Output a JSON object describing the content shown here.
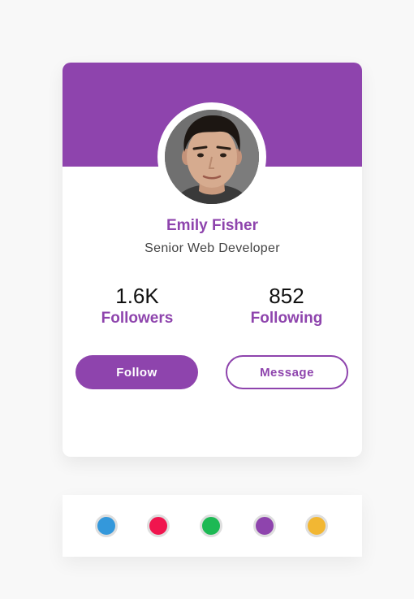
{
  "profile": {
    "name": "Emily Fisher",
    "title": "Senior Web Developer",
    "followers_count": "1.6K",
    "followers_label": "Followers",
    "following_count": "852",
    "following_label": "Following",
    "follow_button": "Follow",
    "message_button": "Message"
  },
  "theme": {
    "accent": "#8e44ad",
    "background": "#f8f8f8"
  },
  "color_options": [
    {
      "name": "blue",
      "color": "#3498db"
    },
    {
      "name": "pink",
      "color": "#f0154e"
    },
    {
      "name": "green",
      "color": "#1db954"
    },
    {
      "name": "purple",
      "color": "#8e44ad"
    },
    {
      "name": "yellow",
      "color": "#f2b733"
    }
  ]
}
